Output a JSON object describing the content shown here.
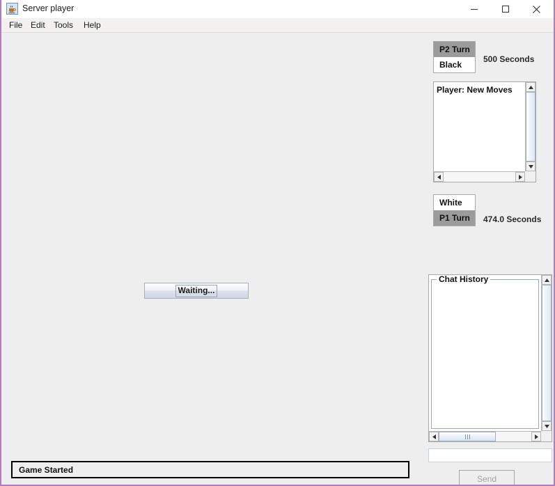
{
  "window": {
    "title": "Server player",
    "app_icon": "java-coffee-cup-icon",
    "controls": {
      "minimize": "minimize-icon",
      "maximize": "maximize-icon",
      "close": "close-icon"
    }
  },
  "menubar": {
    "items": [
      {
        "label": "File"
      },
      {
        "label": "Edit"
      },
      {
        "label": "Tools"
      },
      {
        "label": "Help"
      }
    ]
  },
  "board": {
    "waiting_button_label": "Waiting..."
  },
  "statusbar": {
    "message": "Game Started"
  },
  "players": {
    "top": {
      "turn_label": "P2  Turn",
      "color_label": "Black",
      "seconds_label": "500 Seconds",
      "active": true
    },
    "bottom": {
      "color_label": "White",
      "turn_label": "P1  Turn",
      "seconds_label": "474.0 Seconds",
      "active": true
    }
  },
  "moves_panel": {
    "text": "Player: New Moves",
    "scroll_up_icon": "triangle-up-icon",
    "scroll_down_icon": "triangle-down-icon",
    "scroll_left_icon": "triangle-left-icon",
    "scroll_right_icon": "triangle-right-icon"
  },
  "chat_panel": {
    "title": "Chat History",
    "content": "",
    "scroll_up_icon": "triangle-up-icon",
    "scroll_down_icon": "triangle-down-icon",
    "scroll_left_icon": "triangle-left-icon",
    "scroll_right_icon": "triangle-right-icon"
  },
  "chat_input": {
    "value": "",
    "placeholder": ""
  },
  "send_button": {
    "label": "Send",
    "enabled": false
  },
  "colors": {
    "window_border": "#b07cc0",
    "panel_background": "#eeeeee",
    "active_turn_background": "#9b9b9b",
    "idle_turn_background": "#ffffff",
    "status_border": "#000000",
    "scrollbar_thumb": "#dce6f4"
  }
}
